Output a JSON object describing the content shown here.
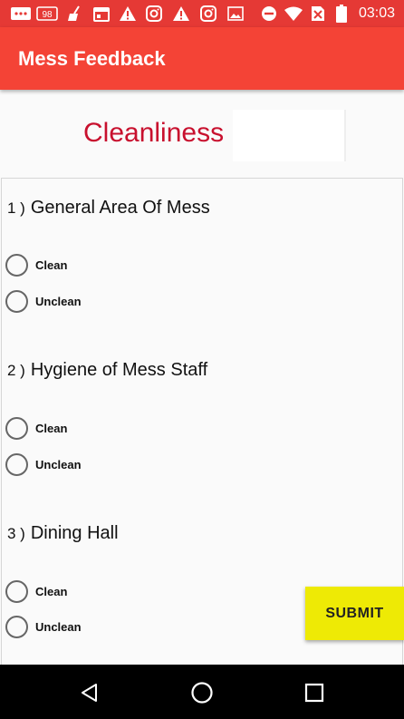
{
  "status_bar": {
    "time": "03:03",
    "icons": [
      "message-icon",
      "notification-98-icon",
      "broom-icon",
      "calendar-icon",
      "warning-icon",
      "instagram-icon",
      "warning-icon",
      "instagram-icon",
      "image-icon",
      "do-not-disturb-icon",
      "wifi-icon",
      "no-sim-icon",
      "battery-icon"
    ],
    "badge_98": "98"
  },
  "app_bar": {
    "title": "Mess Feedback"
  },
  "section": {
    "title": "Cleanliness"
  },
  "questions": [
    {
      "number": "1 )",
      "text": "General Area Of Mess",
      "options": [
        "Clean",
        "Unclean"
      ]
    },
    {
      "number": "2 )",
      "text": "Hygiene of Mess Staff",
      "options": [
        "Clean",
        "Unclean"
      ]
    },
    {
      "number": "3 )",
      "text": "Dining Hall",
      "options": [
        "Clean",
        "Unclean"
      ]
    }
  ],
  "submit_label": "SUBMIT",
  "nav": {
    "icons": [
      "back-icon",
      "home-icon",
      "recents-icon"
    ]
  },
  "colors": {
    "status_bar": "#e53935",
    "app_bar": "#f44336",
    "section_title": "#c8102e",
    "submit": "#eeea05"
  }
}
